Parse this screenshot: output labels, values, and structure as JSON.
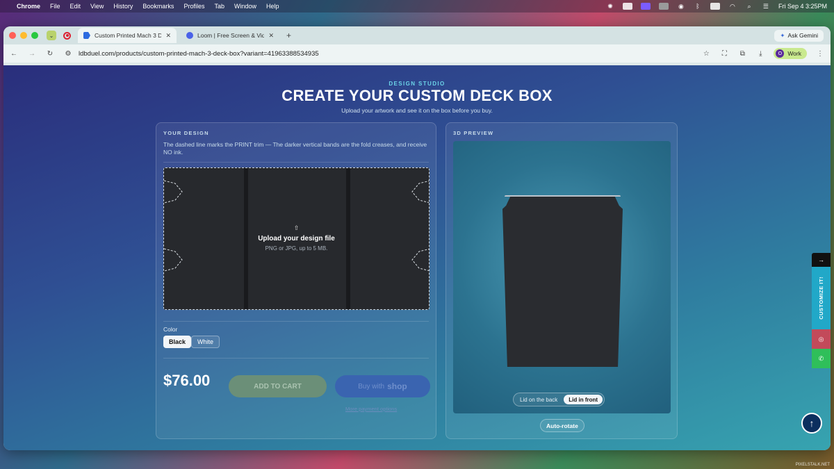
{
  "menubar": {
    "app": "Chrome",
    "items": [
      "File",
      "Edit",
      "View",
      "History",
      "Bookmarks",
      "Profiles",
      "Tab",
      "Window",
      "Help"
    ],
    "clock": "Fri Sep 4  3:25PM"
  },
  "browser": {
    "tabs": [
      {
        "title": "Custom Printed Mach 3 Deck",
        "active": true
      },
      {
        "title": "Loom | Free Screen & Video R",
        "active": false
      }
    ],
    "ask_gemini": "Ask Gemini",
    "url": "ldbduel.com/products/custom-printed-mach-3-deck-box?variant=41963388534935",
    "profile_initial": "O",
    "profile_label": "Work"
  },
  "page": {
    "kicker": "DESIGN STUDIO",
    "title": "CREATE YOUR CUSTOM DECK BOX",
    "subtitle": "Upload your artwork and see it on the box before you buy.",
    "design_panel": {
      "label": "YOUR DESIGN",
      "description": "The dashed line marks the PRINT trim — The darker vertical bands are the fold creases, and receive NO ink.",
      "upload_icon": "⇧",
      "upload_title": "Upload your design file",
      "upload_sub": "PNG or JPG, up to 5 MB.",
      "color_label": "Color",
      "colors": [
        "Black",
        "White"
      ],
      "selected_color": "Black",
      "price": "$76.00",
      "add_to_cart": "ADD TO CART",
      "buy_with": "Buy with",
      "shop": "shop",
      "more_payment": "More payment options"
    },
    "preview_panel": {
      "label": "3D PREVIEW",
      "toggle": [
        "Lid on the back",
        "Lid in front"
      ],
      "selected_toggle": "Lid in front",
      "auto_rotate": "Auto-rotate"
    },
    "side_widget": {
      "customize": "CUSTOMIZE IT!"
    }
  },
  "watermark": "PIXELSTALK.NET"
}
